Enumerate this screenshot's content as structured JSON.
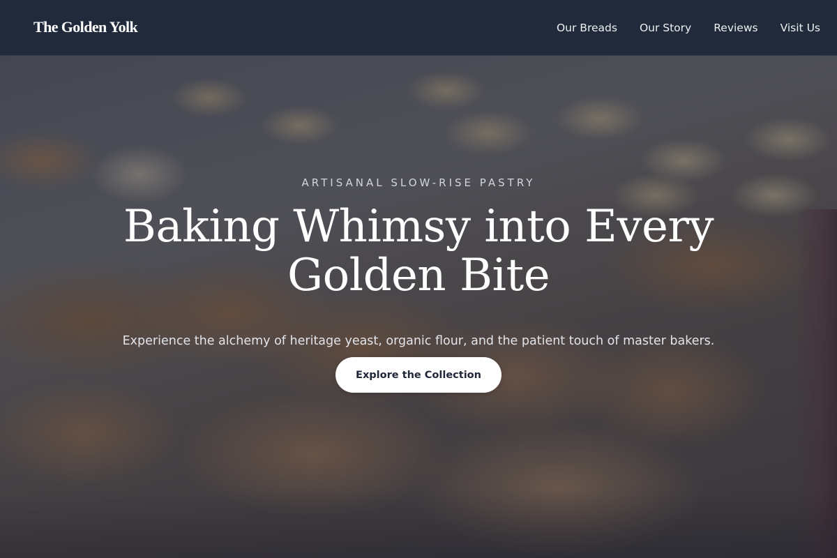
{
  "brand": {
    "name": "The Golden Yolk"
  },
  "nav": {
    "items": [
      {
        "label": "Our Breads"
      },
      {
        "label": "Our Story"
      },
      {
        "label": "Reviews"
      },
      {
        "label": "Visit Us"
      }
    ]
  },
  "hero": {
    "eyebrow": "ARTISANAL SLOW-RISE PASTRY",
    "headline": "Baking Whimsy into Every Golden Bite",
    "subheadline": "Experience the alchemy of heritage yeast, organic flour, and the patient touch of master bakers.",
    "cta_label": "Explore the Collection"
  },
  "colors": {
    "navbar_bg": "#1e2838",
    "overlay": "#1d253a",
    "text_primary": "#ffffff",
    "button_bg": "#ffffff",
    "button_text": "#1e2638"
  }
}
